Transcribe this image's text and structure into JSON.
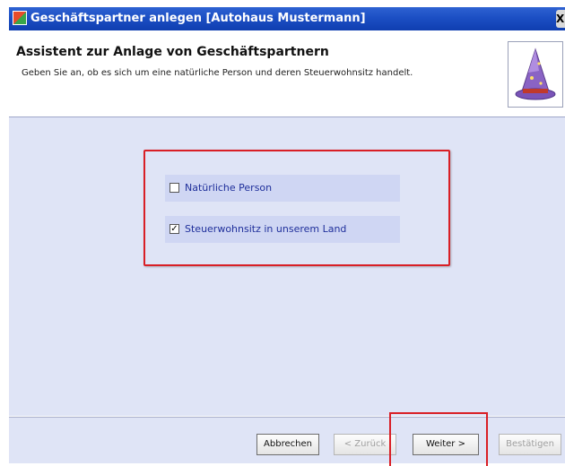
{
  "window": {
    "title": "Geschäftspartner anlegen [Autohaus Mustermann]",
    "close_glyph": "X",
    "app_icon": "app-icon"
  },
  "header": {
    "title": "Assistent zur Anlage von Geschäftspartnern",
    "subtitle": "Geben Sie an, ob es sich um eine natürliche Person und deren Steuerwohnsitz handelt.",
    "icon": "wizard-hat-icon"
  },
  "options": [
    {
      "label": "Natürliche Person",
      "checked": false,
      "check_glyph": ""
    },
    {
      "label": "Steuerwohnsitz in unserem Land",
      "checked": true,
      "check_glyph": "✓"
    }
  ],
  "buttons": {
    "cancel": "Abbrechen",
    "back": "< Zurück",
    "next": "Weiter >",
    "confirm": "Bestätigen"
  },
  "colors": {
    "highlight": "#d91f26",
    "titlebar": "#1c4fc4",
    "panel": "#dfe4f6",
    "option_text": "#1f2f9b"
  }
}
